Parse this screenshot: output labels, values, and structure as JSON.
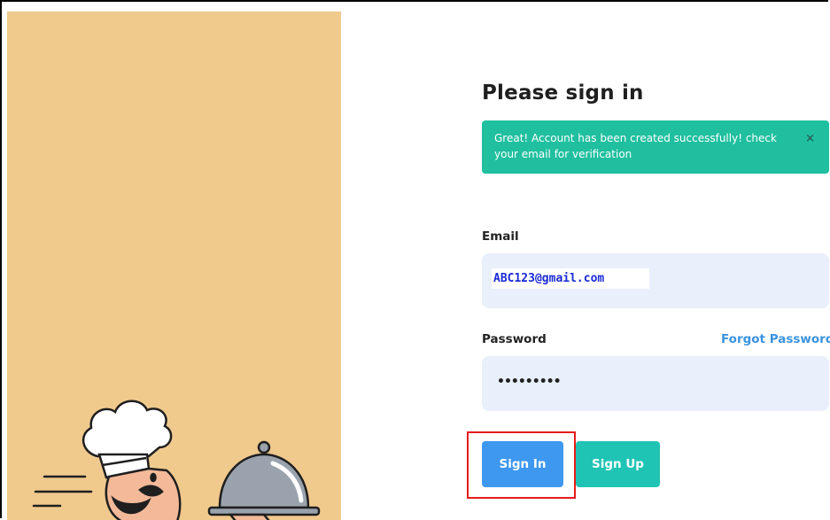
{
  "login": {
    "title": "Please sign in",
    "alert": {
      "message": "Great! Account has been created successfully! check your email for verification",
      "close_glyph": "×"
    },
    "email": {
      "label": "Email",
      "value": "ABC123@gmail.com"
    },
    "password": {
      "label": "Password",
      "masked_value": "•••••••••",
      "forgot_link": "Forgot Password ?"
    },
    "buttons": {
      "sign_in": "Sign In",
      "sign_up": "Sign Up"
    }
  },
  "colors": {
    "left_panel": "#f0c98d",
    "alert_bg": "#1fbf9f",
    "input_bg": "#e9effb",
    "sign_in_bg": "#3e98ef",
    "sign_up_bg": "#1fc4b5",
    "link": "#3b93df",
    "highlight": "#e51c1c"
  },
  "icons": {
    "illustration": "chef-with-cloche-illustration",
    "close": "close-icon"
  }
}
